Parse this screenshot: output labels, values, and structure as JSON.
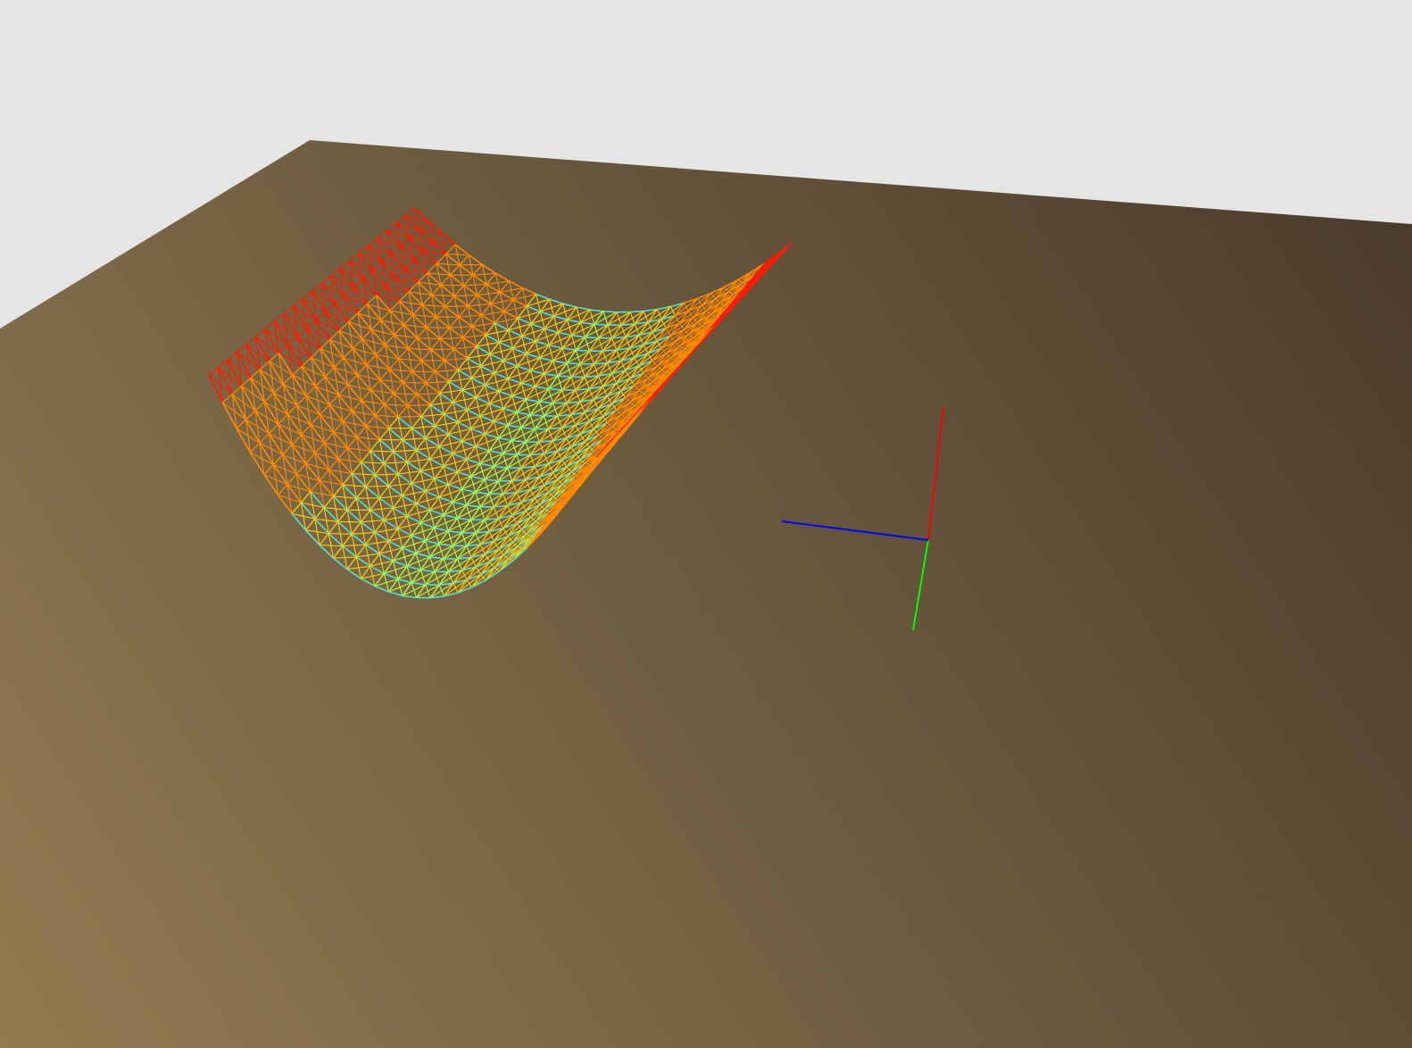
{
  "viewport": {
    "background_color": "#e5e5e5",
    "ground_plane": {
      "near_color": "#917b52",
      "far_color": "#493b2b"
    },
    "surface": {
      "type": "wireframe-mesh",
      "shape": "parabolic-trough",
      "colormap": [
        "#ff1a00",
        "#ff8a00",
        "#ffd000",
        "#b8ff3a",
        "#55e0d0"
      ]
    },
    "axes_gizmo": {
      "x_axis_color": "#0000ff",
      "y_axis_color": "#00ff00",
      "z_axis_color": "#ff0000"
    }
  }
}
